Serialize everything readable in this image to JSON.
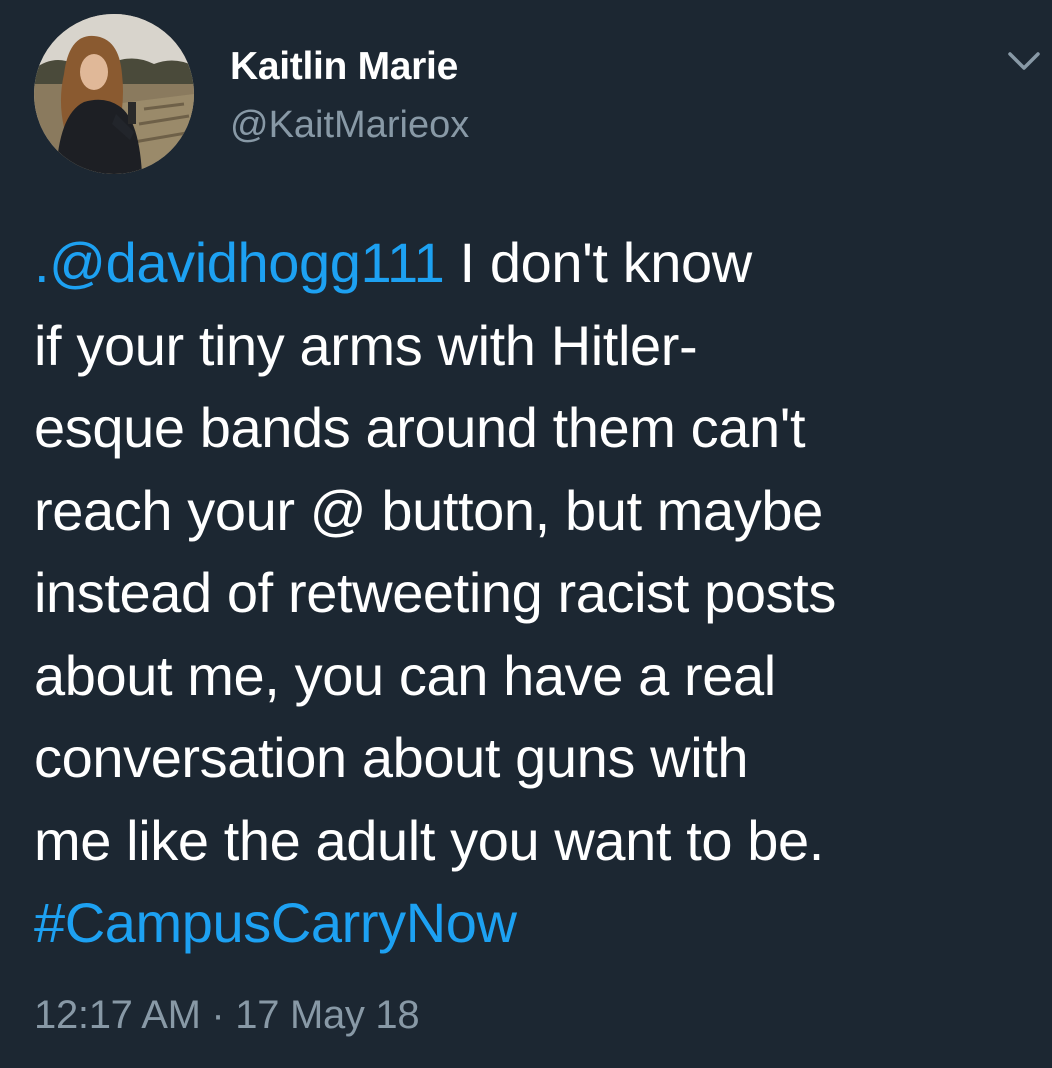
{
  "author": {
    "display_name": "Kaitlin Marie",
    "handle": "@KaitMarieox"
  },
  "tweet": {
    "mention": ".@davidhogg111",
    "line1_rest": " I don't know",
    "line2": "if your tiny arms with Hitler-",
    "line3": "esque bands around them can't",
    "line4": "reach your @ button, but maybe",
    "line5": "instead of retweeting racist posts",
    "line6": "about me, you can have a real",
    "line7": "conversation about guns with",
    "line8": "me like the adult you want to be.",
    "hashtag": "#CampusCarryNow"
  },
  "timestamp": "12:17 AM · 17 May 18",
  "icons": {
    "menu": "chevron-down-icon"
  },
  "colors": {
    "background": "#1c2732",
    "link": "#1da1f2",
    "secondary_text": "#8899a6"
  }
}
